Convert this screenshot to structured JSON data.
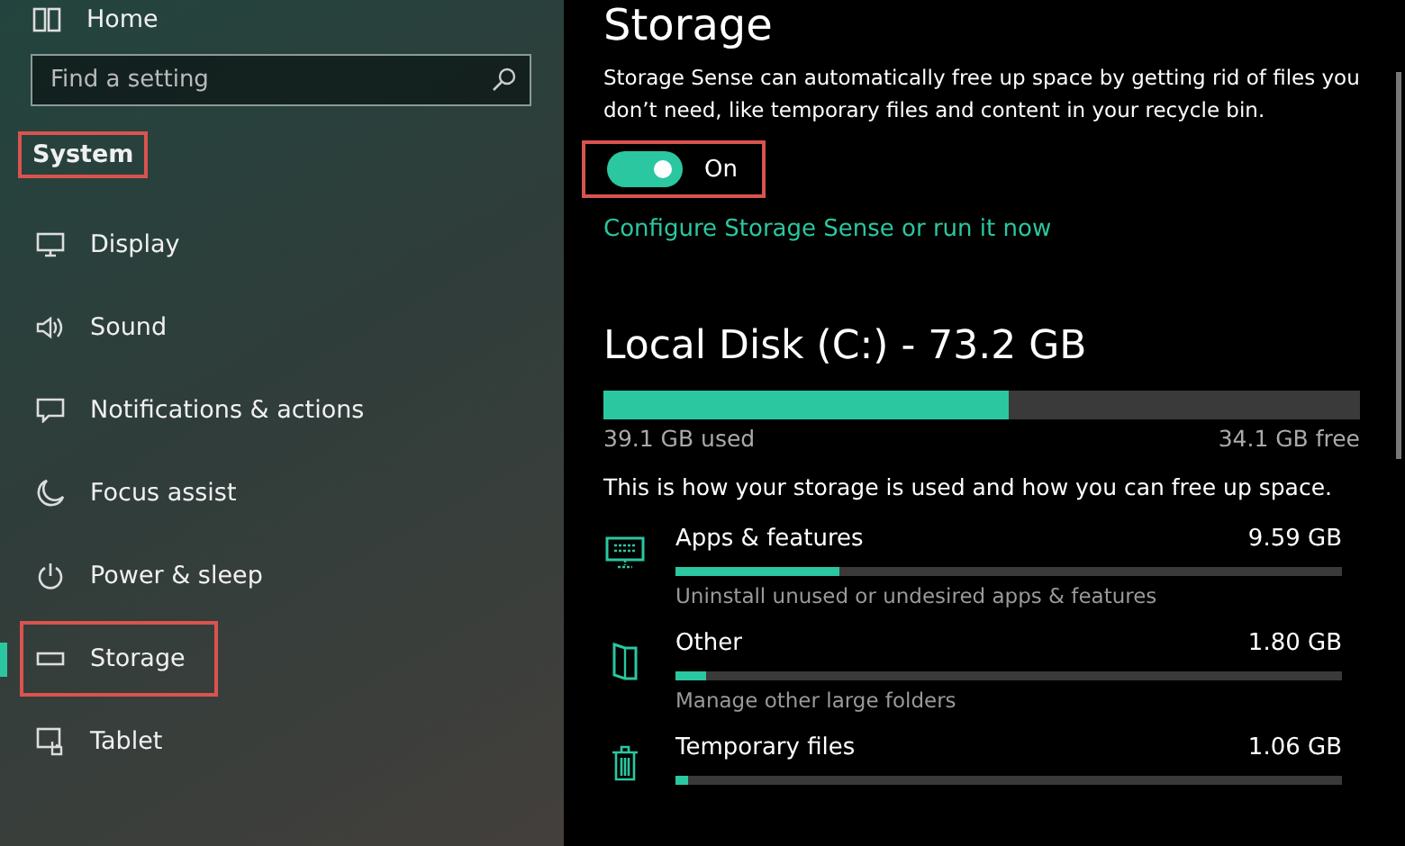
{
  "sidebar": {
    "home": {
      "label": "Home"
    },
    "search": {
      "placeholder": "Find a setting"
    },
    "section": {
      "label": "System",
      "highlighted": true
    },
    "items": [
      {
        "label": "Display",
        "selected": false,
        "highlighted": false
      },
      {
        "label": "Sound",
        "selected": false,
        "highlighted": false
      },
      {
        "label": "Notifications & actions",
        "selected": false,
        "highlighted": false
      },
      {
        "label": "Focus assist",
        "selected": false,
        "highlighted": false
      },
      {
        "label": "Power & sleep",
        "selected": false,
        "highlighted": false
      },
      {
        "label": "Storage",
        "selected": true,
        "highlighted": true
      },
      {
        "label": "Tablet",
        "selected": false,
        "highlighted": false
      }
    ]
  },
  "content": {
    "title": "Storage",
    "description": "Storage Sense can automatically free up space by getting rid of files you don’t need, like temporary files and content in your recycle bin.",
    "toggle": {
      "on": true,
      "label": "On",
      "highlighted": true
    },
    "link": "Configure Storage Sense or run it now",
    "disk": {
      "title": "Local Disk (C:) - 73.2 GB",
      "level": 0.535,
      "used": "39.1 GB used",
      "free": "34.1 GB free"
    },
    "intro": "This is how your storage is used and how you can free up space.",
    "categories": [
      {
        "name": "Apps & features",
        "size": "9.59 GB",
        "level": 0.245,
        "hint": "Uninstall unused or undesired apps & features"
      },
      {
        "name": "Other",
        "size": "1.80 GB",
        "level": 0.045,
        "hint": "Manage other large folders"
      },
      {
        "name": "Temporary files",
        "size": "1.06 GB",
        "level": 0.02
      }
    ]
  }
}
